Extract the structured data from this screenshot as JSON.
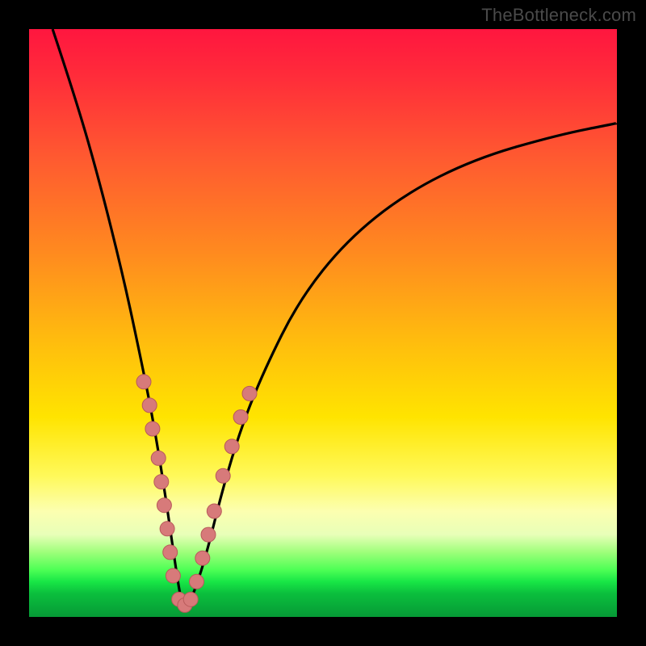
{
  "watermark": "TheBottleneck.com",
  "colors": {
    "curve_stroke": "#000000",
    "marker_fill": "#d77a7a",
    "marker_stroke": "#b85a5a"
  },
  "chart_data": {
    "type": "line",
    "title": "",
    "xlabel": "",
    "ylabel": "",
    "xlim": [
      0,
      100
    ],
    "ylim": [
      0,
      100
    ],
    "curve": {
      "description": "V-shaped bottleneck curve with minimum near x≈26, left branch steep, right branch rising concave",
      "points_xy_percent": [
        [
          4,
          100
        ],
        [
          8,
          88
        ],
        [
          12,
          74
        ],
        [
          16,
          58
        ],
        [
          19,
          44
        ],
        [
          21,
          34
        ],
        [
          23,
          22
        ],
        [
          25,
          8
        ],
        [
          26,
          2
        ],
        [
          27,
          2
        ],
        [
          28,
          4
        ],
        [
          30,
          10
        ],
        [
          33,
          22
        ],
        [
          36,
          32
        ],
        [
          40,
          42
        ],
        [
          46,
          54
        ],
        [
          54,
          64
        ],
        [
          64,
          72
        ],
        [
          76,
          78
        ],
        [
          90,
          82
        ],
        [
          100,
          84
        ]
      ]
    },
    "markers_xy_percent": [
      [
        19.5,
        40
      ],
      [
        20.5,
        36
      ],
      [
        21.0,
        32
      ],
      [
        22.0,
        27
      ],
      [
        22.5,
        23
      ],
      [
        23.0,
        19
      ],
      [
        23.5,
        15
      ],
      [
        24.0,
        11
      ],
      [
        24.5,
        7
      ],
      [
        25.5,
        3
      ],
      [
        26.5,
        2
      ],
      [
        27.5,
        3
      ],
      [
        28.5,
        6
      ],
      [
        29.5,
        10
      ],
      [
        30.5,
        14
      ],
      [
        31.5,
        18
      ],
      [
        33.0,
        24
      ],
      [
        34.5,
        29
      ],
      [
        36.0,
        34
      ],
      [
        37.5,
        38
      ]
    ]
  }
}
